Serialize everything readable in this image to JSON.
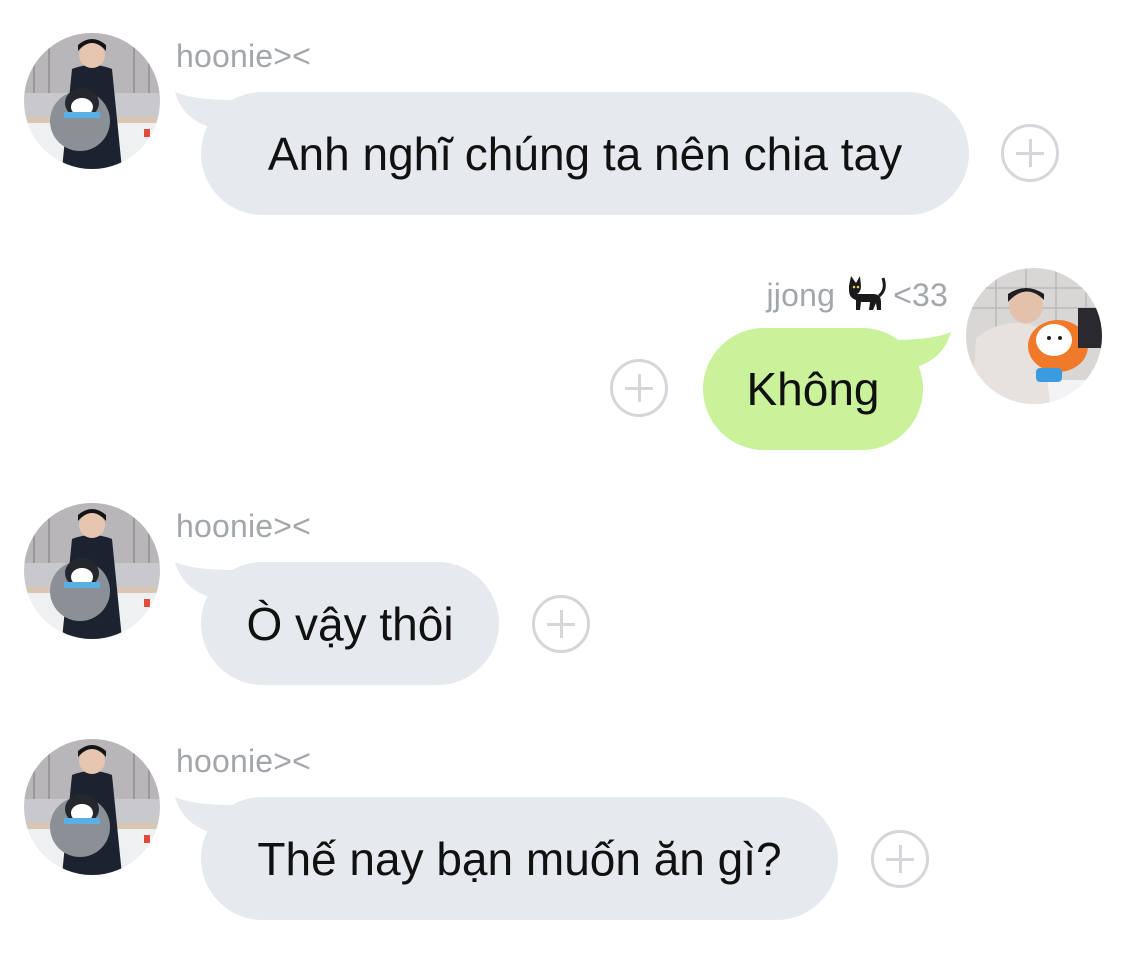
{
  "messages": [
    {
      "sender": "hoonie><",
      "text": "Anh nghĩ chúng ta nên chia tay",
      "direction": "incoming"
    },
    {
      "sender_name": "jjong",
      "sender_emoji_icon": "black-cat-icon",
      "sender_suffix": "<33",
      "text": "Không",
      "direction": "outgoing"
    },
    {
      "sender": "hoonie><",
      "text": "Ò vậy thôi",
      "direction": "incoming"
    },
    {
      "sender": "hoonie><",
      "text": "Thế nay bạn muốn ăn gì?",
      "direction": "incoming"
    }
  ],
  "colors": {
    "incoming_bubble": "#e6e9ed",
    "outgoing_bubble": "#c9f29b",
    "sender_text": "#a3a6ab",
    "plus_icon": "#d4d6da"
  }
}
